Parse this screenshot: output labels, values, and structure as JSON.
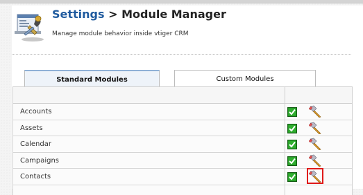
{
  "header": {
    "title_link": "Settings",
    "title_sep": " > ",
    "title_rest": "Module Manager",
    "subtitle": "Manage module behavior inside vtiger CRM"
  },
  "tabs": [
    {
      "label": "Standard Modules",
      "active": true
    },
    {
      "label": "Custom Modules",
      "active": false
    }
  ],
  "modules": [
    {
      "name": "Accounts",
      "enabled": true
    },
    {
      "name": "Assets",
      "enabled": true
    },
    {
      "name": "Calendar",
      "enabled": true
    },
    {
      "name": "Campaigns",
      "enabled": true
    },
    {
      "name": "Contacts",
      "enabled": true,
      "highlighted": true
    }
  ],
  "colors": {
    "link": "#1f5a9e",
    "check_green": "#2a9a2a",
    "highlight_red": "#e01919"
  },
  "icons": {
    "header": "module-manager-icon",
    "enable": "green-checkbox-icon",
    "settings": "hammer-tool-icon"
  }
}
